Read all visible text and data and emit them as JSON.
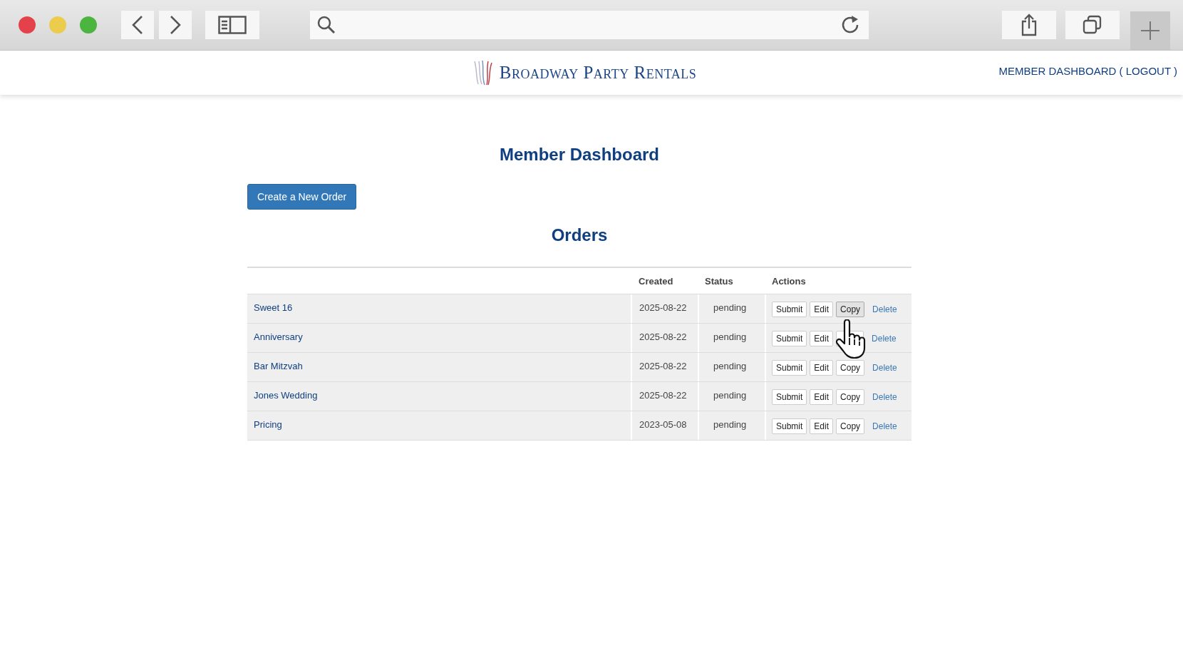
{
  "brand": {
    "name": "Broadway Party Rentals"
  },
  "nav": {
    "link": "MEMBER DASHBOARD ( LOGOUT )"
  },
  "title": "Member Dashboard",
  "create_button": "Create a New Order",
  "orders": {
    "heading": "Orders",
    "columns": [
      "Created",
      "Status",
      "Actions"
    ],
    "rows": [
      {
        "name": "Sweet 16",
        "created": "2025-08-22",
        "status": "pending",
        "actions": [
          {
            "kind": "button",
            "label": "Submit",
            "hovered": false
          },
          {
            "kind": "button",
            "label": "Edit",
            "hovered": false
          },
          {
            "kind": "button",
            "label": "Copy",
            "hovered": true
          },
          {
            "kind": "link",
            "label": "Delete"
          }
        ]
      },
      {
        "name": "Anniversary",
        "created": "2025-08-22",
        "status": "pending",
        "actions": [
          {
            "kind": "button",
            "label": "Submit",
            "hovered": false
          },
          {
            "kind": "button",
            "label": "Edit",
            "hovered": false
          },
          {
            "kind": "button",
            "hovered": false
          },
          {
            "kind": "link",
            "label": "Delete"
          }
        ]
      },
      {
        "name": "Bar Mitzvah",
        "created": "2025-08-22",
        "status": "pending",
        "actions": [
          {
            "kind": "button",
            "label": "Submit",
            "hovered": false
          },
          {
            "kind": "button",
            "label": "Edit",
            "hovered": false
          },
          {
            "kind": "button",
            "label": "Copy",
            "hovered": false
          },
          {
            "kind": "link",
            "label": "Delete"
          }
        ]
      },
      {
        "name": "Jones Wedding",
        "created": "2025-08-22",
        "status": "pending",
        "actions": [
          {
            "kind": "button",
            "label": "Submit",
            "hovered": false
          },
          {
            "kind": "button",
            "label": "Edit",
            "hovered": false
          },
          {
            "kind": "button",
            "label": "Copy",
            "hovered": false
          },
          {
            "kind": "link",
            "label": "Delete"
          }
        ]
      },
      {
        "name": "Pricing",
        "created": "2023-05-08",
        "status": "pending",
        "actions": [
          {
            "kind": "button",
            "label": "Submit",
            "hovered": false
          },
          {
            "kind": "button",
            "label": "Edit",
            "hovered": false
          },
          {
            "kind": "button",
            "label": "Copy",
            "hovered": false
          },
          {
            "kind": "link",
            "label": "Delete"
          }
        ]
      }
    ]
  }
}
